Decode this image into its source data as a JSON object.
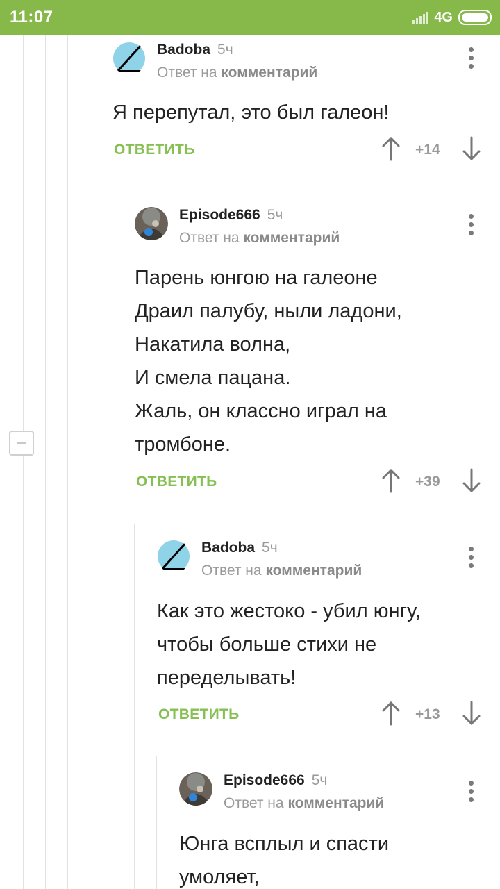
{
  "status_bar": {
    "time": "11:07",
    "network": "4G"
  },
  "comments": [
    {
      "author": "Badoba",
      "age": "5ч",
      "reply_prefix": "Ответ на",
      "reply_target": "комментарий",
      "text": "Я перепутал, это был галеон!",
      "reply_label": "ОТВЕТИТЬ",
      "score": "+14"
    },
    {
      "author": "Episode666",
      "age": "5ч",
      "reply_prefix": "Ответ на",
      "reply_target": "комментарий",
      "text": "Парень юнгою на галеоне\nДраил палубу, ныли ладони,\nНакатила волна,\nИ смела пацана.\nЖаль, он классно играл на\nтромбоне.",
      "reply_label": "ОТВЕТИТЬ",
      "score": "+39"
    },
    {
      "author": "Badoba",
      "age": "5ч",
      "reply_prefix": "Ответ на",
      "reply_target": "комментарий",
      "text": "Как это жестоко - убил юнгу,\nчтобы больше стихи не\nпеределывать!",
      "reply_label": "ОТВЕТИТЬ",
      "score": "+13"
    },
    {
      "author": "Episode666",
      "age": "5ч",
      "reply_prefix": "Ответ на",
      "reply_target": "комментарий",
      "text": "Юнга всплыл и спасти\nумоляет,",
      "reply_label": "",
      "score": ""
    }
  ],
  "colors": {
    "status_bar": "#86b84a",
    "accent": "#86c052",
    "muted": "#9a9a9a"
  },
  "icons": [
    "signal-icon",
    "battery-icon",
    "upvote-icon",
    "downvote-icon",
    "more-icon",
    "collapse-icon"
  ]
}
